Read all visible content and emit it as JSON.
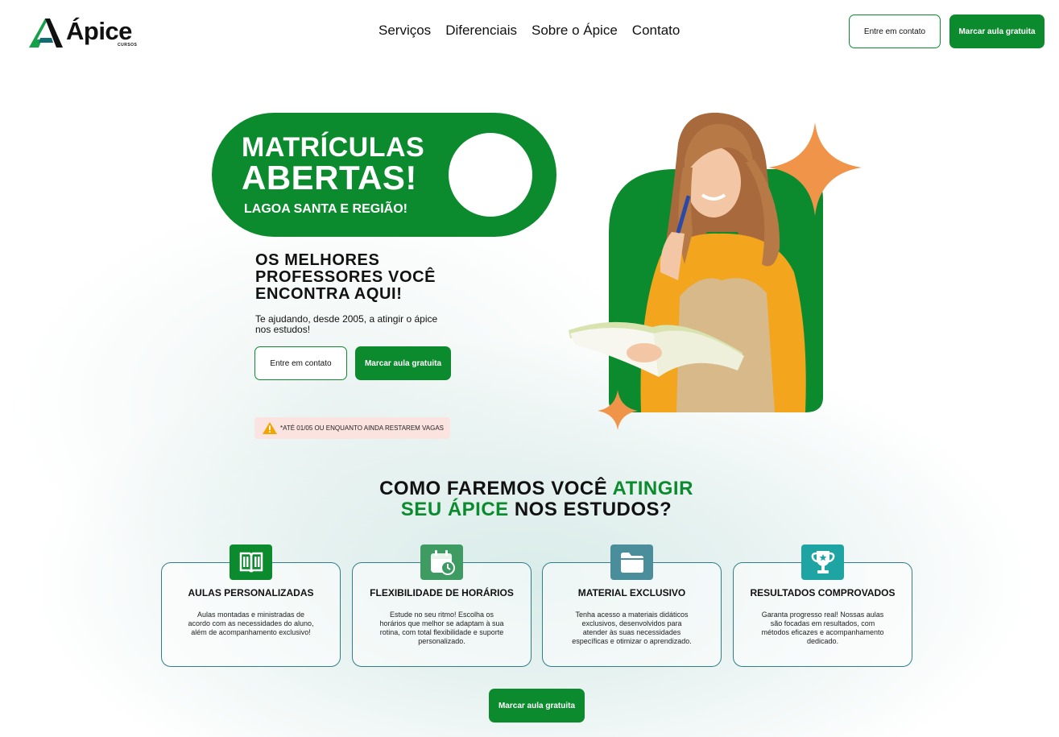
{
  "brand": {
    "name": "Ápice",
    "subtitle": "CURSOS"
  },
  "nav": [
    "Serviços",
    "Diferenciais",
    "Sobre o Ápice",
    "Contato"
  ],
  "header_buttons": {
    "contact": "Entre em contato",
    "schedule": "Marcar aula gratuita"
  },
  "hero": {
    "banner_line1": "MATRÍCULAS",
    "banner_line2": "ABERTAS!",
    "banner_line3": "LAGOA SANTA E REGIÃO!",
    "title": "OS MELHORES PROFESSORES VOCÊ ENCONTRA AQUI!",
    "text": "Te ajudando, desde 2005, a atingir o ápice nos estudos!",
    "contact_button": "Entre em contato",
    "schedule_button": "Marcar aula gratuita",
    "notice": "*ATÉ 01/05 OU ENQUANTO AINDA RESTAREM VAGAS"
  },
  "section": {
    "title_part1": "COMO FAREMOS VOCÊ ",
    "title_highlight1": "ATINGIR",
    "title_highlight2": "SEU ÁPICE",
    "title_part2": " NOS ESTUDOS?",
    "cards": [
      {
        "title": "AULAS PERSONALIZADAS",
        "text": "Aulas montadas e ministradas de acordo com as necessidades do aluno, além de acompanhamento exclusivo!",
        "icon": "book-icon",
        "color": "#0c8a2e"
      },
      {
        "title": "FLEXIBILIDADE DE HORÁRIOS",
        "text": "Estude no seu ritmo! Escolha os horários que melhor se adaptam à sua rotina, com total flexibilidade e suporte personalizado.",
        "icon": "calendar-clock-icon",
        "color": "#3e9c62"
      },
      {
        "title": "MATERIAL EXCLUSIVO",
        "text": "Tenha acesso a materiais didáticos exclusivos, desenvolvidos para atender às suas necessidades específicas e otimizar o aprendizado.",
        "icon": "folder-icon",
        "color": "#4a8d9b"
      },
      {
        "title": "RESULTADOS COMPROVADOS",
        "text": "Garanta progresso real! Nossas aulas são focadas em resultados, com métodos eficazes e acompanhamento dedicado.",
        "icon": "trophy-icon",
        "color": "#1ea5a3"
      }
    ],
    "cta": "Marcar aula gratuita"
  },
  "colors": {
    "primary": "#0c8a2e",
    "accent_orange": "#f0944a",
    "notice_bg": "#fbe3e0"
  }
}
